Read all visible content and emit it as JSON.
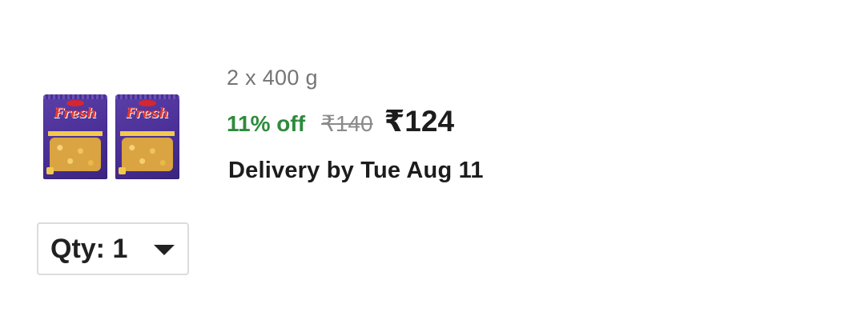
{
  "product": {
    "image_icon": "snack-pack-image",
    "pack_brand_text": "Fresh",
    "variant": "2 x 400 g",
    "discount": "11% off",
    "mrp": "₹140",
    "price": "₹124",
    "delivery": "Delivery by Tue Aug 11"
  },
  "quantity": {
    "label": "Qty: 1",
    "icon": "caret-down-icon"
  },
  "colors": {
    "discount_green": "#2e8b3d",
    "pack_purple": "#4a2f96"
  }
}
